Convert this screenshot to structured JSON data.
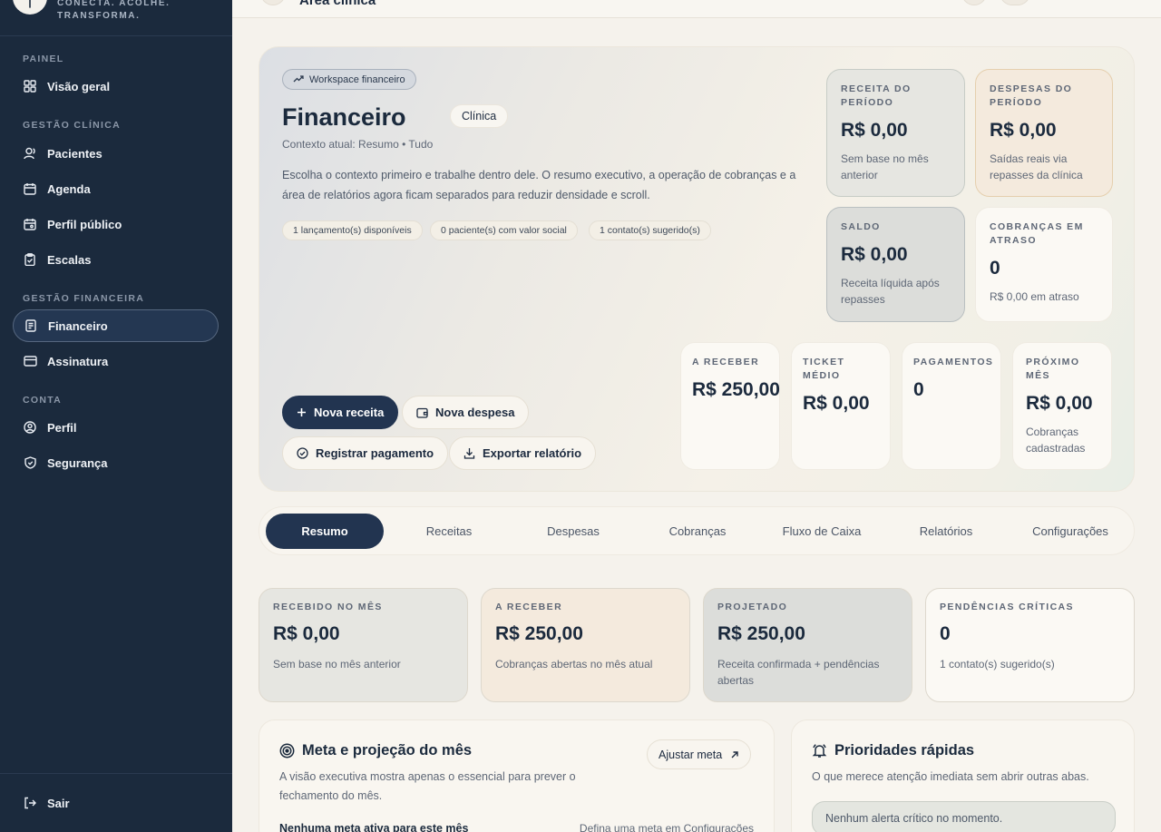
{
  "brand": {
    "tagline_1": "CONECTA. ACOLHE.",
    "tagline_2": "TRANSFORMA.",
    "logo_icon": "leaf-icon"
  },
  "sidebar": {
    "sections": [
      {
        "title": "PAINEL",
        "items": [
          {
            "label": "Visão geral",
            "icon": "grid-icon"
          }
        ]
      },
      {
        "title": "GESTÃO CLÍNICA",
        "items": [
          {
            "label": "Pacientes",
            "icon": "users-icon"
          },
          {
            "label": "Agenda",
            "icon": "calendar-icon"
          },
          {
            "label": "Perfil público",
            "icon": "calendar-user-icon"
          },
          {
            "label": "Escalas",
            "icon": "clipboard-icon"
          }
        ]
      },
      {
        "title": "GESTÃO FINANCEIRA",
        "items": [
          {
            "label": "Financeiro",
            "icon": "receipt-icon",
            "active": true
          },
          {
            "label": "Assinatura",
            "icon": "credit-card-icon"
          }
        ]
      },
      {
        "title": "CONTA",
        "items": [
          {
            "label": "Perfil",
            "icon": "user-circle-icon"
          },
          {
            "label": "Segurança",
            "icon": "shield-icon"
          }
        ]
      }
    ],
    "logout_label": "Sair"
  },
  "topbar": {
    "title": "Área clínica"
  },
  "hero": {
    "chip": "Workspace financeiro",
    "title": "Financeiro",
    "badge": "Clínica",
    "context": "Contexto atual: Resumo • Tudo",
    "description": "Escolha o contexto primeiro e trabalhe dentro dele. O resumo executivo, a operação de cobranças e a área de relatórios agora ficam separados para reduzir densidade e scroll.",
    "pills": [
      "1 lançamento(s) disponíveis",
      "0 paciente(s) com valor social",
      "1 contato(s) sugerido(s)"
    ],
    "buttons": {
      "nova_receita": "Nova receita",
      "nova_despesa": "Nova despesa",
      "registrar_pagamento": "Registrar pagamento",
      "exportar_relatorio": "Exportar relatório"
    },
    "kpis_large": [
      {
        "label": "RECEITA DO PERÍODO",
        "value": "R$ 0,00",
        "sub": "Sem base no mês anterior"
      },
      {
        "label": "DESPESAS DO PERÍODO",
        "value": "R$ 0,00",
        "sub": "Saídas reais via repasses da clínica"
      },
      {
        "label": "SALDO",
        "value": "R$ 0,00",
        "sub": "Receita líquida após repasses"
      },
      {
        "label": "COBRANÇAS EM ATRASO",
        "value": "0",
        "sub": "R$ 0,00 em atraso"
      }
    ],
    "kpis_small": [
      {
        "label": "A RECEBER",
        "value": "R$ 250,00",
        "sub": ""
      },
      {
        "label": "TICKET MÉDIO",
        "value": "R$ 0,00",
        "sub": ""
      },
      {
        "label": "PAGAMENTOS",
        "value": "0",
        "sub": ""
      },
      {
        "label": "PRÓXIMO MÊS",
        "value": "R$ 0,00",
        "sub": "Cobranças cadastradas"
      }
    ]
  },
  "tabs": [
    "Resumo",
    "Receitas",
    "Despesas",
    "Cobranças",
    "Fluxo de Caixa",
    "Relatórios",
    "Configurações"
  ],
  "summary_cards": [
    {
      "label": "RECEBIDO NO MÊS",
      "value": "R$ 0,00",
      "sub": "Sem base no mês anterior"
    },
    {
      "label": "A RECEBER",
      "value": "R$ 250,00",
      "sub": "Cobranças abertas no mês atual"
    },
    {
      "label": "PROJETADO",
      "value": "R$ 250,00",
      "sub": "Receita confirmada + pendências abertas"
    },
    {
      "label": "PENDÊNCIAS CRÍTICAS",
      "value": "0",
      "sub": "1 contato(s) sugerido(s)"
    }
  ],
  "meta_panel": {
    "title": "Meta e projeção do mês",
    "description": "A visão executiva mostra apenas o essencial para prever o fechamento do mês.",
    "button": "Ajustar meta",
    "empty_label": "Nenhuma meta ativa para este mês",
    "hint": "Defina uma meta em Configurações"
  },
  "priorities_panel": {
    "title": "Prioridades rápidas",
    "description": "O que merece atenção imediata sem abrir outras abas.",
    "alert": "Nenhum alerta crítico no momento."
  }
}
